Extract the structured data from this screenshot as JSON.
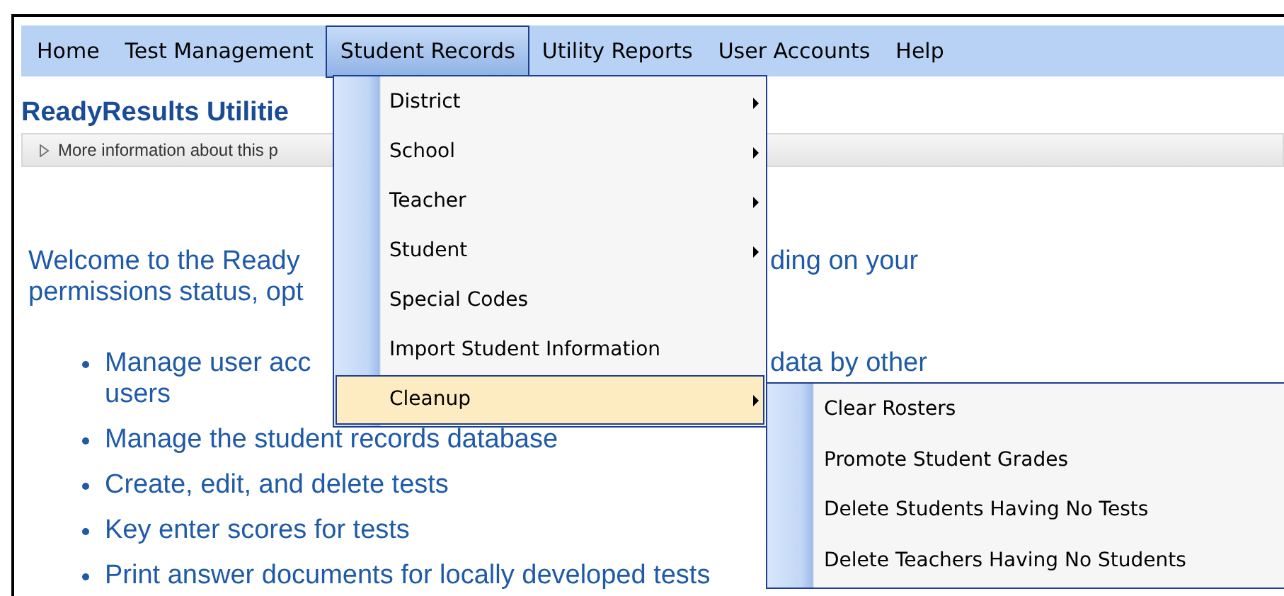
{
  "menu_bar": {
    "items": [
      {
        "label": "Home",
        "selected": false
      },
      {
        "label": "Test Management",
        "selected": false
      },
      {
        "label": "Student Records",
        "selected": true
      },
      {
        "label": "Utility Reports",
        "selected": false
      },
      {
        "label": "User Accounts",
        "selected": false
      },
      {
        "label": "Help",
        "selected": false
      }
    ]
  },
  "page": {
    "title": "ReadyResults Utilitie",
    "info_bar": {
      "text": "More information about this p"
    },
    "intro": [
      {
        "left": "Welcome to the Ready",
        "right": "ding on your"
      },
      {
        "left": "permissions status, opt"
      }
    ],
    "bullets": [
      {
        "left": "Manage user acc",
        "right": "data by other",
        "continuation": "users"
      },
      {
        "left": "Manage the student records database"
      },
      {
        "left": "Create, edit, and delete tests"
      },
      {
        "left": "Key enter scores for tests"
      },
      {
        "left": "Print answer documents for locally developed tests"
      }
    ]
  },
  "dropdown": {
    "items": [
      {
        "label": "District",
        "has_submenu": true,
        "selected": false
      },
      {
        "label": "School",
        "has_submenu": true,
        "selected": false
      },
      {
        "label": "Teacher",
        "has_submenu": true,
        "selected": false
      },
      {
        "label": "Student",
        "has_submenu": true,
        "selected": false
      },
      {
        "label": "Special Codes",
        "has_submenu": false,
        "selected": false
      },
      {
        "label": "Import Student Information",
        "has_submenu": false,
        "selected": false
      },
      {
        "label": "Cleanup",
        "has_submenu": true,
        "selected": true
      }
    ]
  },
  "submenu": {
    "items": [
      {
        "label": "Clear Rosters"
      },
      {
        "label": "Promote Student Grades"
      },
      {
        "label": "Delete Students Having No Tests"
      },
      {
        "label": "Delete Teachers Having No Students"
      }
    ]
  }
}
